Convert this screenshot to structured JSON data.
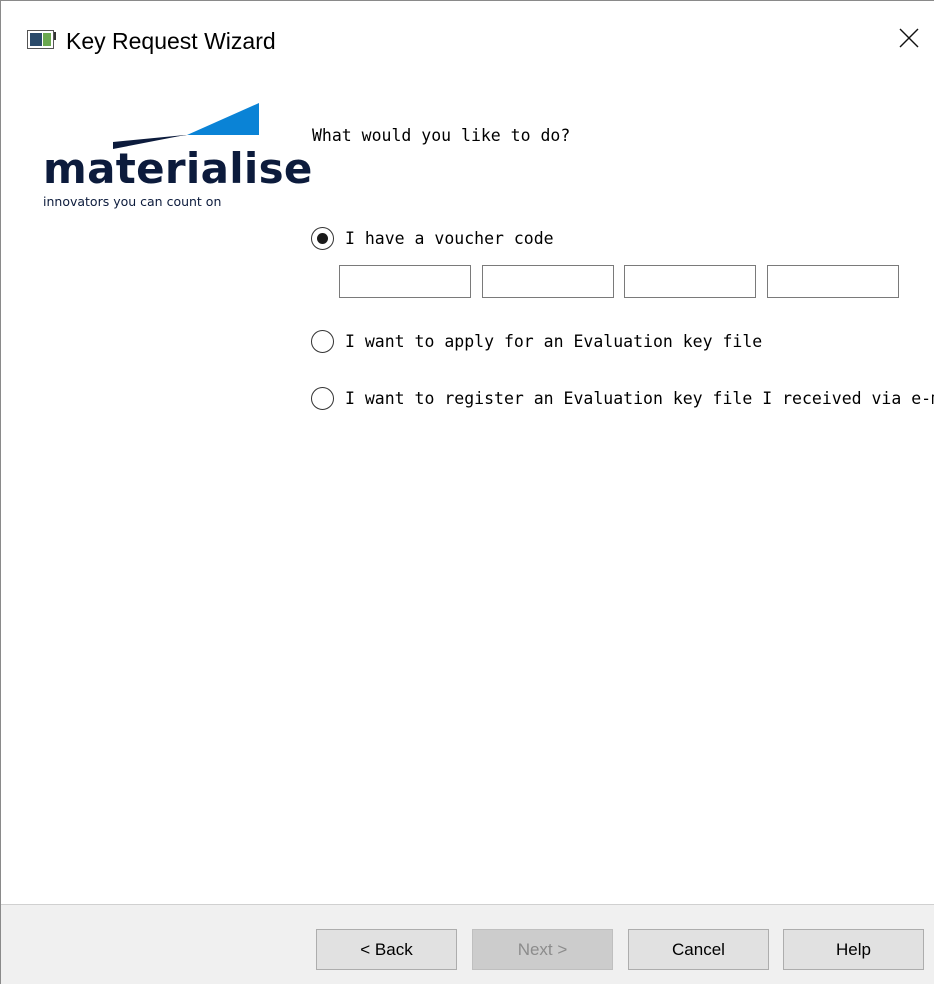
{
  "window": {
    "title": "Key Request Wizard"
  },
  "logo": {
    "brand": "materialise",
    "tagline": "innovators you can count on"
  },
  "content": {
    "question": "What would you like to do?",
    "options": [
      {
        "label": "I have a voucher code",
        "checked": true
      },
      {
        "label": "I want to apply for an Evaluation key file",
        "checked": false
      },
      {
        "label": "I want to register an Evaluation key file I received via e-mail",
        "checked": false
      }
    ],
    "voucher_fields": [
      "",
      "",
      "",
      ""
    ]
  },
  "buttons": {
    "back": "< Back",
    "next": "Next >",
    "cancel": "Cancel",
    "help": "Help"
  },
  "colors": {
    "brand_blue": "#0a83d6",
    "brand_navy": "#0c1b3c",
    "footer_bg": "#f0f0f0"
  }
}
